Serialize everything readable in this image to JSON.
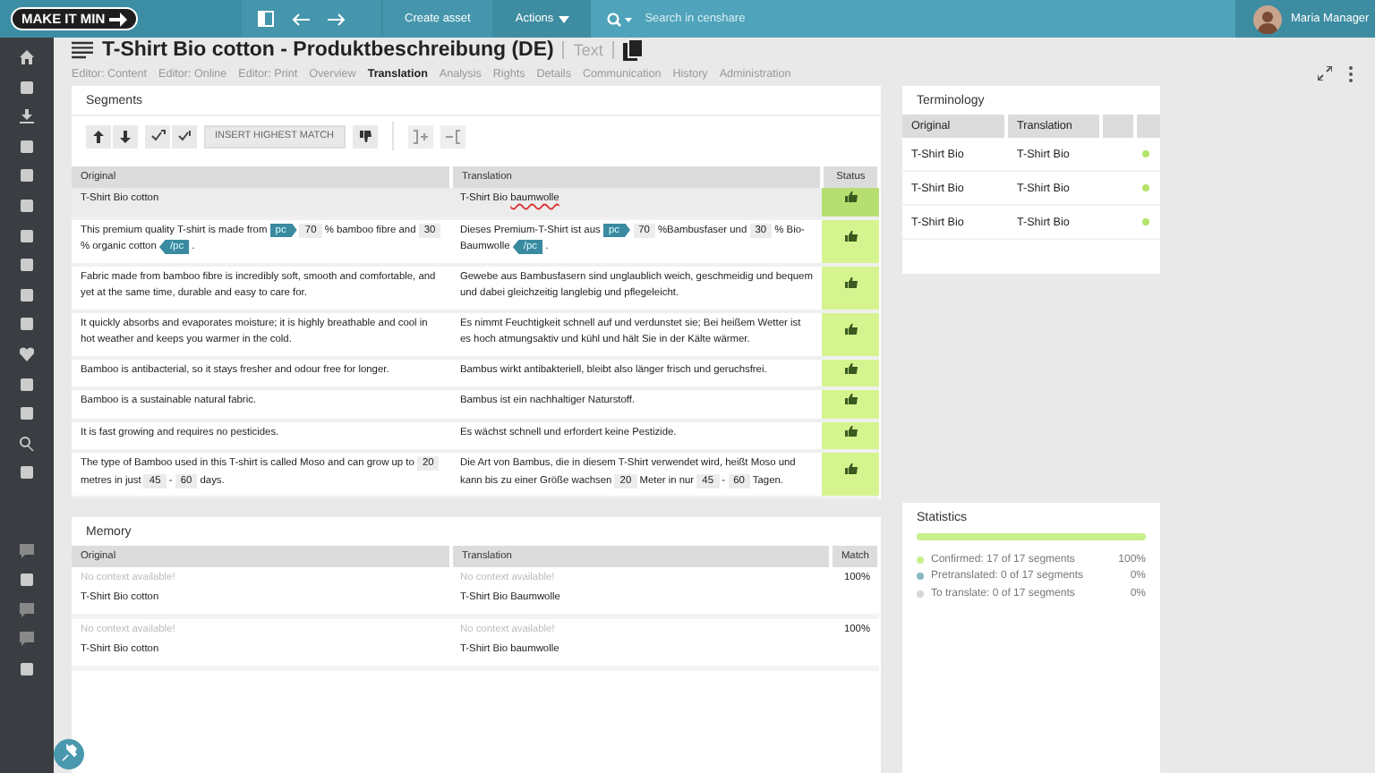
{
  "topbar": {
    "logo": "MAKE IT MIN",
    "create": "Create asset",
    "actions": "Actions",
    "search": {
      "placeholder": "Search in censhare"
    },
    "user": "Maria Manager"
  },
  "header": {
    "title": "T-Shirt Bio cotton - Produktbeschreibung (DE)",
    "type": "Text",
    "tabs": [
      {
        "label": "Editor: Content",
        "selected": false
      },
      {
        "label": "Editor: Online",
        "selected": false
      },
      {
        "label": "Editor: Print",
        "selected": false
      },
      {
        "label": "Overview",
        "selected": false
      },
      {
        "label": "Translation",
        "selected": true
      },
      {
        "label": "Analysis",
        "selected": false
      },
      {
        "label": "Rights",
        "selected": false
      },
      {
        "label": "Details",
        "selected": false
      },
      {
        "label": "Communication",
        "selected": false
      },
      {
        "label": "History",
        "selected": false
      },
      {
        "label": "Administration",
        "selected": false
      }
    ]
  },
  "segments": {
    "title": "Segments",
    "insert_button": "INSERT HIGHEST MATCH",
    "columns": [
      "Original",
      "Translation",
      "Status"
    ],
    "rows": [
      {
        "selected": true,
        "original": [
          {
            "kind": "text",
            "text": "T-Shirt Bio cotton"
          }
        ],
        "translation": [
          {
            "kind": "text",
            "text": "T-Shirt Bio "
          },
          {
            "kind": "misspelled",
            "text": "baumwolle"
          }
        ]
      },
      {
        "selected": false,
        "original": [
          {
            "kind": "text",
            "text": "This premium quality T-shirt is made from"
          },
          {
            "kind": "open",
            "text": "pc"
          },
          {
            "kind": "num",
            "text": "70"
          },
          {
            "kind": "text",
            "text": "% bamboo fibre and"
          },
          {
            "kind": "num",
            "text": "30"
          },
          {
            "kind": "text",
            "text": "% organic cotton"
          },
          {
            "kind": "close",
            "text": "/pc"
          },
          {
            "kind": "text",
            "text": "."
          }
        ],
        "translation": [
          {
            "kind": "text",
            "text": "Dieses Premium-T-Shirt ist aus"
          },
          {
            "kind": "open",
            "text": "pc"
          },
          {
            "kind": "num",
            "text": "70"
          },
          {
            "kind": "text",
            "text": "%Bambusfaser und"
          },
          {
            "kind": "num",
            "text": "30"
          },
          {
            "kind": "text",
            "text": "% Bio-Baumwolle"
          },
          {
            "kind": "close",
            "text": "/pc"
          },
          {
            "kind": "text",
            "text": "."
          }
        ]
      },
      {
        "selected": false,
        "original": [
          {
            "kind": "text",
            "text": "Fabric made from bamboo fibre is incredibly soft, smooth and comfortable, and yet at the same time, durable and easy to care for."
          }
        ],
        "translation": [
          {
            "kind": "text",
            "text": "Gewebe aus Bambusfasern sind unglaublich weich, geschmeidig und bequem und dabei gleichzeitig langlebig und pflegeleicht."
          }
        ]
      },
      {
        "selected": false,
        "original": [
          {
            "kind": "text",
            "text": "It quickly absorbs and evaporates moisture; it is highly breathable and cool in hot weather and keeps you warmer in the cold."
          }
        ],
        "translation": [
          {
            "kind": "text",
            "text": "Es nimmt Feuchtigkeit schnell auf und verdunstet sie; Bei heißem Wetter ist es hoch atmungsaktiv und kühl und hält Sie in der Kälte wärmer."
          }
        ]
      },
      {
        "selected": false,
        "original": [
          {
            "kind": "text",
            "text": "Bamboo is antibacterial, so it stays fresher and odour free for longer."
          }
        ],
        "translation": [
          {
            "kind": "text",
            "text": "Bambus wirkt antibakteriell, bleibt also länger frisch und geruchsfrei."
          }
        ]
      },
      {
        "selected": false,
        "original": [
          {
            "kind": "text",
            "text": "Bamboo is a sustainable natural fabric."
          }
        ],
        "translation": [
          {
            "kind": "text",
            "text": "Bambus ist ein nachhaltiger Naturstoff."
          }
        ]
      },
      {
        "selected": false,
        "original": [
          {
            "kind": "text",
            "text": "It is fast growing and requires no pesticides."
          }
        ],
        "translation": [
          {
            "kind": "text",
            "text": "Es wächst schnell und erfordert keine Pestizide."
          }
        ]
      },
      {
        "selected": false,
        "original": [
          {
            "kind": "text",
            "text": "The type of Bamboo used in this T-shirt is called Moso and can grow up to"
          },
          {
            "kind": "num",
            "text": "20"
          },
          {
            "kind": "text",
            "text": "metres in just"
          },
          {
            "kind": "num",
            "text": "45"
          },
          {
            "kind": "text",
            "text": "-"
          },
          {
            "kind": "num",
            "text": "60"
          },
          {
            "kind": "text",
            "text": "days."
          }
        ],
        "translation": [
          {
            "kind": "text",
            "text": "Die Art von Bambus, die in diesem T-Shirt verwendet wird, heißt Moso und kann bis zu einer Größe wachsen"
          },
          {
            "kind": "num",
            "text": "20"
          },
          {
            "kind": "text",
            "text": "Meter in nur"
          },
          {
            "kind": "num",
            "text": "45"
          },
          {
            "kind": "text",
            "text": "-"
          },
          {
            "kind": "num",
            "text": "60"
          },
          {
            "kind": "text",
            "text": "Tagen."
          }
        ]
      }
    ]
  },
  "memory": {
    "title": "Memory",
    "columns": [
      "Original",
      "Translation",
      "Match"
    ],
    "rows": [
      {
        "original_context": "No context available!",
        "original": "T-Shirt Bio cotton",
        "translation_context": "No context available!",
        "translation": "T-Shirt Bio Baumwolle",
        "match": "100%"
      },
      {
        "original_context": "No context available!",
        "original": "T-Shirt Bio cotton",
        "translation_context": "No context available!",
        "translation": "T-Shirt Bio baumwolle",
        "match": "100%"
      }
    ]
  },
  "terminology": {
    "title": "Terminology",
    "columns": [
      "Original",
      "Translation"
    ],
    "rows": [
      {
        "original": "T-Shirt Bio",
        "translation": "T-Shirt Bio",
        "color": "#b5e36a"
      },
      {
        "original": "T-Shirt Bio",
        "translation": "T-Shirt Bio",
        "color": "#b5e36a"
      },
      {
        "original": "T-Shirt Bio",
        "translation": "T-Shirt Bio",
        "color": "#b5e36a"
      }
    ]
  },
  "statistics": {
    "title": "Statistics",
    "level": 1,
    "items": [
      {
        "label": "Confirmed: 17 of 17 segments",
        "percent": "100%",
        "color": "#c8f08a"
      },
      {
        "label": "Pretranslated: 0 of 17 segments",
        "percent": "0%",
        "color": "#8ab8c8"
      },
      {
        "label": "To translate: 0 of 17 segments",
        "percent": "0%",
        "color": "#d6d6d6"
      }
    ]
  }
}
